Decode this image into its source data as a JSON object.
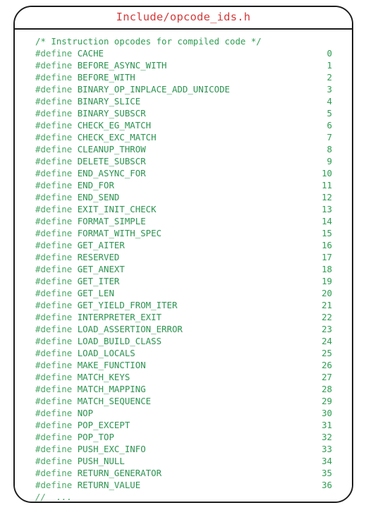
{
  "card": {
    "title": "Include/opcode_ids.h",
    "title_color": "#d23b3b",
    "border_color": "#1c1c1c",
    "background_color": "#ffffff"
  },
  "code": {
    "directive_keyword": "#define",
    "text_color": "#2f9e52",
    "header_comment": "/* Instruction opcodes for compiled code */",
    "trailing_comment": "//  ...",
    "defines": [
      {
        "name": "CACHE",
        "value": "0"
      },
      {
        "name": "BEFORE_ASYNC_WITH",
        "value": "1"
      },
      {
        "name": "BEFORE_WITH",
        "value": "2"
      },
      {
        "name": "BINARY_OP_INPLACE_ADD_UNICODE",
        "value": "3"
      },
      {
        "name": "BINARY_SLICE",
        "value": "4"
      },
      {
        "name": "BINARY_SUBSCR",
        "value": "5"
      },
      {
        "name": "CHECK_EG_MATCH",
        "value": "6"
      },
      {
        "name": "CHECK_EXC_MATCH",
        "value": "7"
      },
      {
        "name": "CLEANUP_THROW",
        "value": "8"
      },
      {
        "name": "DELETE_SUBSCR",
        "value": "9"
      },
      {
        "name": "END_ASYNC_FOR",
        "value": "10"
      },
      {
        "name": "END_FOR",
        "value": "11"
      },
      {
        "name": "END_SEND",
        "value": "12"
      },
      {
        "name": "EXIT_INIT_CHECK",
        "value": "13"
      },
      {
        "name": "FORMAT_SIMPLE",
        "value": "14"
      },
      {
        "name": "FORMAT_WITH_SPEC",
        "value": "15"
      },
      {
        "name": "GET_AITER",
        "value": "16"
      },
      {
        "name": "RESERVED",
        "value": "17"
      },
      {
        "name": "GET_ANEXT",
        "value": "18"
      },
      {
        "name": "GET_ITER",
        "value": "19"
      },
      {
        "name": "GET_LEN",
        "value": "20"
      },
      {
        "name": "GET_YIELD_FROM_ITER",
        "value": "21"
      },
      {
        "name": "INTERPRETER_EXIT",
        "value": "22"
      },
      {
        "name": "LOAD_ASSERTION_ERROR",
        "value": "23"
      },
      {
        "name": "LOAD_BUILD_CLASS",
        "value": "24"
      },
      {
        "name": "LOAD_LOCALS",
        "value": "25"
      },
      {
        "name": "MAKE_FUNCTION",
        "value": "26"
      },
      {
        "name": "MATCH_KEYS",
        "value": "27"
      },
      {
        "name": "MATCH_MAPPING",
        "value": "28"
      },
      {
        "name": "MATCH_SEQUENCE",
        "value": "29"
      },
      {
        "name": "NOP",
        "value": "30"
      },
      {
        "name": "POP_EXCEPT",
        "value": "31"
      },
      {
        "name": "POP_TOP",
        "value": "32"
      },
      {
        "name": "PUSH_EXC_INFO",
        "value": "33"
      },
      {
        "name": "PUSH_NULL",
        "value": "34"
      },
      {
        "name": "RETURN_GENERATOR",
        "value": "35"
      },
      {
        "name": "RETURN_VALUE",
        "value": "36"
      }
    ]
  }
}
